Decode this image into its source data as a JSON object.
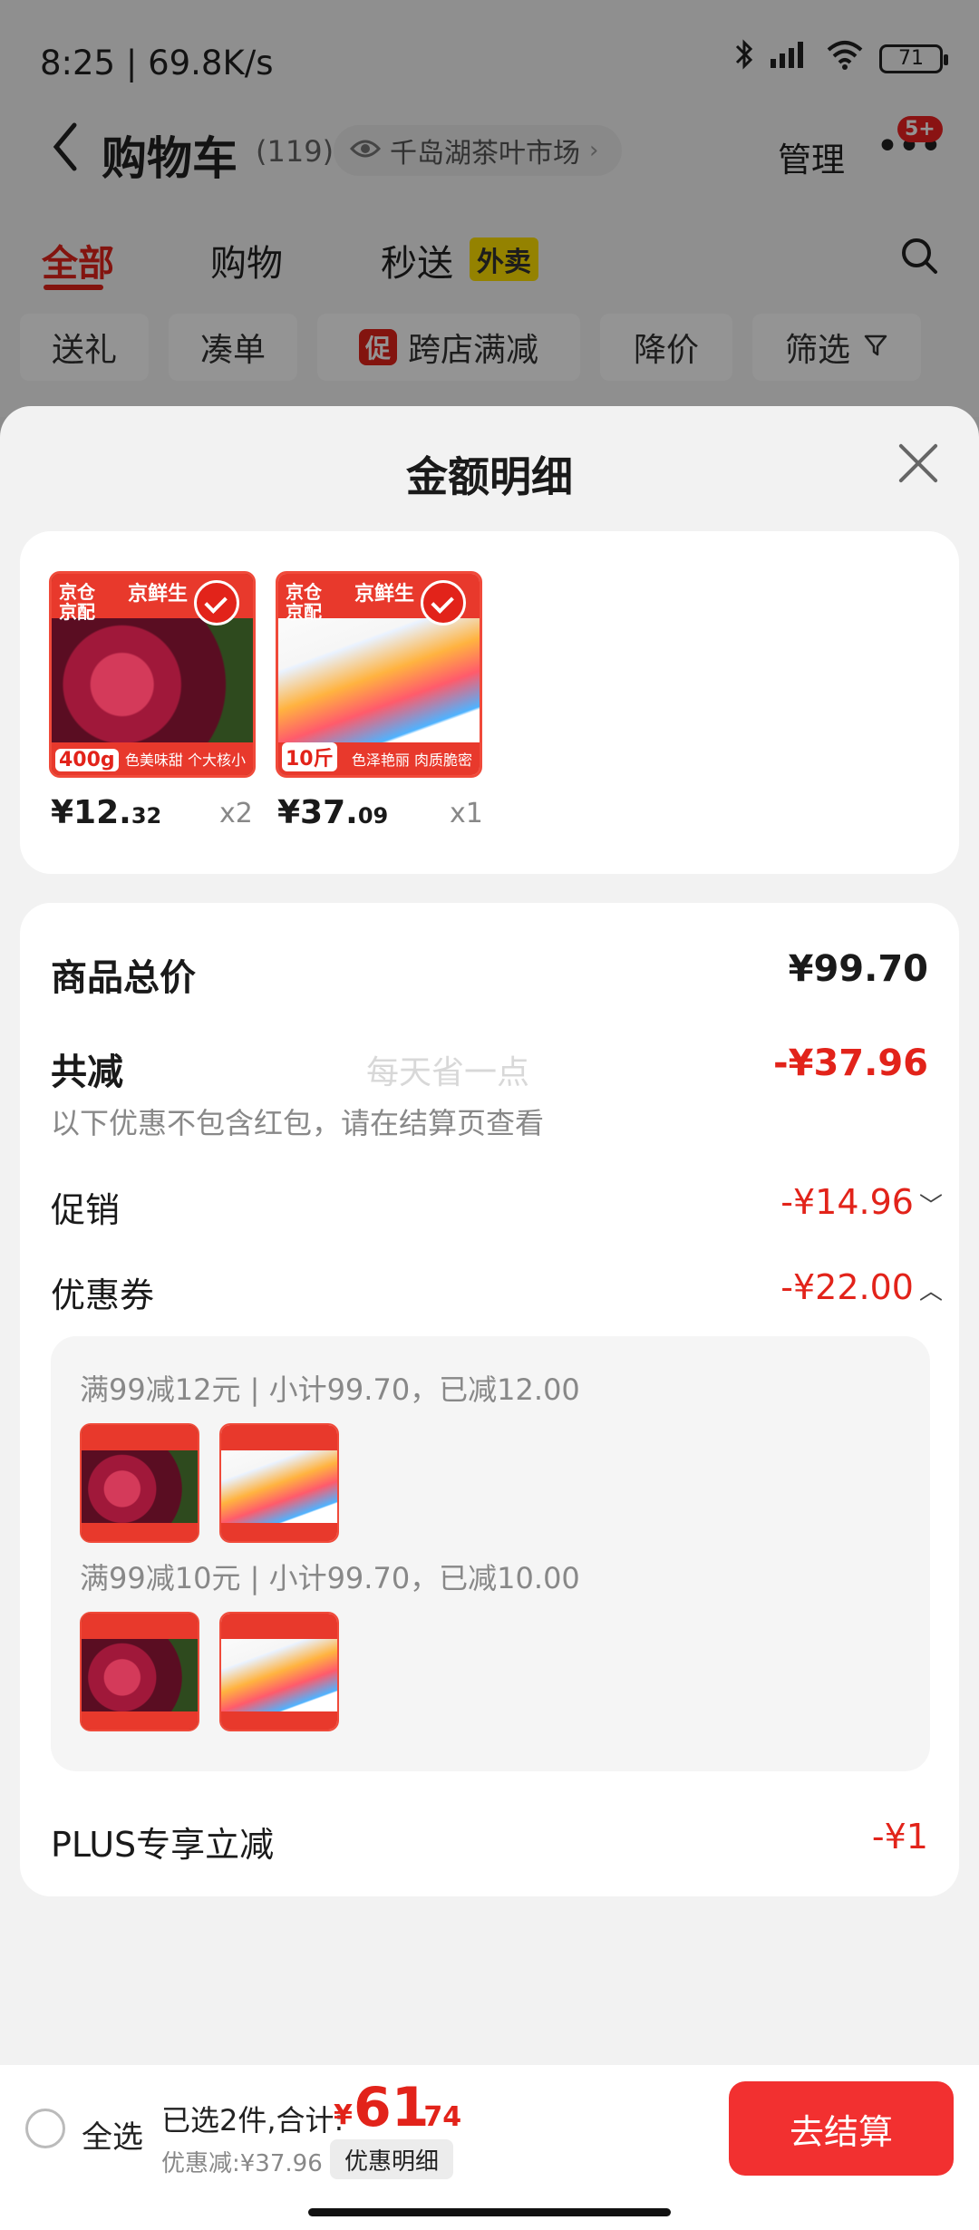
{
  "status_bar": {
    "time": "8:25 | 69.8K/s",
    "battery": "71",
    "bluetooth_icon": "bluetooth-icon",
    "signal_icon": "signal-icon",
    "wifi_icon": "wifi-icon"
  },
  "header": {
    "title": "购物车",
    "count": "(119)",
    "store": "千岛湖茶叶市场",
    "manage": "管理",
    "badge": "5+"
  },
  "tabs": [
    {
      "label": "全部"
    },
    {
      "label": "购物"
    },
    {
      "label": "秒送"
    }
  ],
  "waimai_tag": "外卖",
  "chips": [
    {
      "label": "送礼"
    },
    {
      "label": "凑单"
    },
    {
      "label": "跨店满减"
    },
    {
      "label": "降价"
    },
    {
      "label": "筛选"
    }
  ],
  "promo_tag": "促",
  "sheet": {
    "title": "金额明细"
  },
  "products": [
    {
      "brand1": "京仓",
      "brand2": "京配",
      "brand_right": "京鲜生",
      "weight": "400g",
      "tag": "色美味甜 个大核小",
      "price_int": "¥12.",
      "price_dec": "32",
      "qty": "x2"
    },
    {
      "brand1": "京仓",
      "brand2": "京配",
      "brand_right": "京鲜生",
      "weight": "10斤",
      "tag": "色泽艳丽 肉质脆密",
      "price_int": "¥37.",
      "price_dec": "09",
      "qty": "x1"
    }
  ],
  "summary": {
    "total_label": "商品总价",
    "total_value": "¥99.70",
    "reduce_label": "共减",
    "reduce_value": "-¥37.96",
    "reduce_note": "以下优惠不包含红包，请在结算页查看",
    "watermark": "每天省一点",
    "promo_label": "促销",
    "promo_value": "-¥14.96",
    "coupon_label": "优惠券",
    "coupon_value": "-¥22.00",
    "coupon_lines": [
      "满99减12元 | 小计99.70，已减12.00",
      "满99减10元 | 小计99.70，已减10.00"
    ],
    "plus_label": "PLUS专享立减",
    "plus_value": "-¥1"
  },
  "bottom": {
    "select_all": "全选",
    "selected": "已选2件,合计:",
    "yen": "¥",
    "total_int": "61",
    "total_dec": ".74",
    "discount": "优惠减:¥37.96",
    "detail_button": "优惠明细",
    "checkout": "去结算"
  }
}
